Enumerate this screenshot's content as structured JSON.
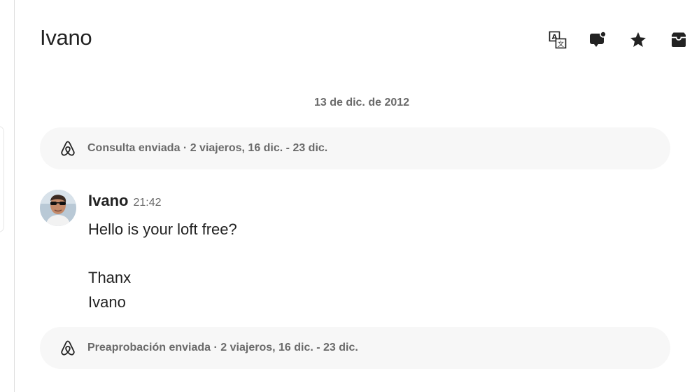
{
  "header": {
    "title": "Ivano",
    "actions": [
      {
        "icon": "translate-icon"
      },
      {
        "icon": "message-notification-icon"
      },
      {
        "icon": "star-icon"
      },
      {
        "icon": "archive-icon"
      }
    ]
  },
  "thread": {
    "date": "13 de dic. de 2012",
    "events": [
      {
        "icon": "airbnb-logo-icon",
        "text": "Consulta enviada · 2 viajeros, 16 dic. - 23 dic."
      },
      {
        "icon": "airbnb-logo-icon",
        "text": "Preaprobación enviada · 2 viajeros, 16 dic. - 23 dic."
      }
    ],
    "message": {
      "sender": "Ivano",
      "time": "21:42",
      "lines": [
        "Hello is your loft free?",
        "",
        "Thanx",
        "Ivano"
      ]
    }
  }
}
